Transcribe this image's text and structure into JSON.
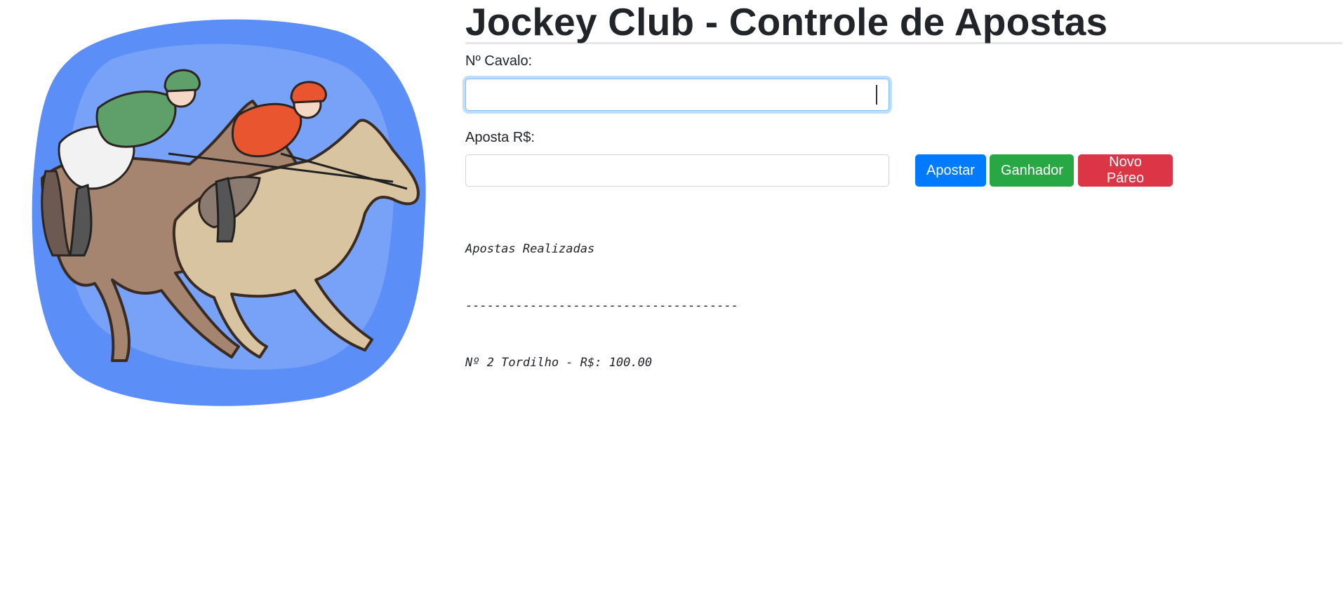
{
  "page": {
    "title": "Jockey Club - Controle de Apostas"
  },
  "form": {
    "horse_label": "Nº Cavalo:",
    "horse_value": "",
    "bet_label": "Aposta R$:",
    "bet_value": ""
  },
  "buttons": {
    "bet": "Apostar",
    "winner": "Ganhador",
    "new_race": "Novo Páreo"
  },
  "bets": {
    "header": "Apostas Realizadas",
    "separator": "--------------------------------------",
    "entries": [
      "Nº 2 Tordilho - R$: 100.00"
    ]
  },
  "colors": {
    "primary": "#007bff",
    "success": "#28a745",
    "danger": "#dc3545",
    "illustration_background": "#5b8ef7"
  },
  "illustration": {
    "icon": "horse-race-icon"
  }
}
